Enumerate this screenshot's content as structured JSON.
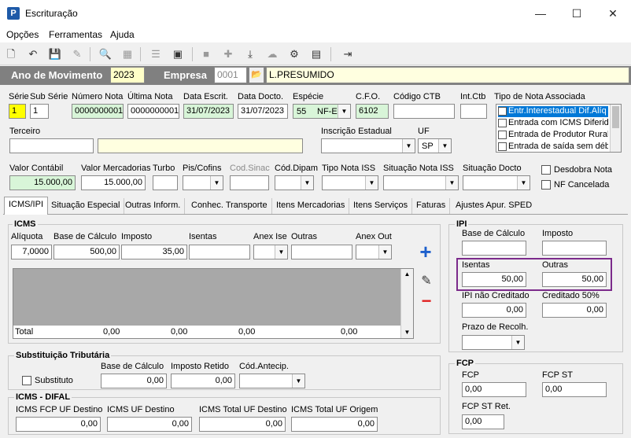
{
  "window": {
    "title": "Escrituração",
    "app_icon": "P",
    "minimize": "—",
    "maximize": "☐",
    "close": "✕"
  },
  "menu": [
    "Opções",
    "Ferramentas",
    "Ajuda"
  ],
  "header": {
    "ano_label": "Ano de Movimento",
    "ano_value": "2023",
    "empresa_label": "Empresa",
    "empresa_code": "0001",
    "empresa_name": "L.PRESUMIDO"
  },
  "doc": {
    "serie_label": "Série",
    "serie": "1",
    "subserie_label": "Sub Série",
    "subserie": "1",
    "numero_label": "Número Nota",
    "numero": "0000000001",
    "ultima_label": "Última Nota",
    "ultima": "0000000001",
    "data_escrit_label": "Data Escrit.",
    "data_escrit": "31/07/2023",
    "data_docto_label": "Data Docto.",
    "data_docto": "31/07/2023",
    "especie_label": "Espécie",
    "especie_code": "55",
    "especie": "NF-E",
    "cfo_label": "C.F.O.",
    "cfo": "6102",
    "codigo_ctb_label": "Código CTB",
    "codigo_ctb": "",
    "int_ctb_label": "Int.Ctb",
    "int_ctb": "",
    "tipo_nota_label": "Tipo de Nota Associada",
    "tipo_nota_items": [
      "Entr.Interestadual Dif.Alíq",
      "Entrada com ICMS Diferido",
      "Entrada de Produtor Rural",
      "Entrada de saída sem débi"
    ]
  },
  "terceiro": {
    "label": "Terceiro",
    "code": "",
    "name": "",
    "ie_label": "Inscrição Estadual",
    "ie": "",
    "uf_label": "UF",
    "uf": "SP"
  },
  "valores": {
    "valor_contabil_label": "Valor Contábil",
    "valor_contabil": "15.000,00",
    "valor_merc_label": "Valor Mercadorias",
    "valor_merc": "15.000,00",
    "turbo_label": "Turbo",
    "piscofins_label": "Pis/Cofins",
    "cod_sinac_label": "Cod.Sinac",
    "cod_dipam_label": "Cód.Dipam",
    "tipo_nota_iss_label": "Tipo Nota ISS",
    "situacao_iss_label": "Situação Nota ISS",
    "situacao_docto_label": "Situação Docto",
    "desdobra_label": "Desdobra Nota",
    "nf_cancelada_label": "NF Cancelada"
  },
  "tabs": [
    "ICMS/IPI",
    "Situação Especial",
    "Outras Inform.",
    "Conhec. Transporte",
    "Itens Mercadorias",
    "Itens Serviços",
    "Faturas",
    "Ajustes Apur. SPED"
  ],
  "icms": {
    "title": "ICMS",
    "aliquota_label": "Alíquota",
    "aliquota": "7,0000",
    "base_label": "Base de Cálculo",
    "base": "500,00",
    "imposto_label": "Imposto",
    "imposto": "35,00",
    "isentas_label": "Isentas",
    "isentas": "",
    "anex_ise_label": "Anex Ise",
    "outras_label": "Outras",
    "outras": "",
    "anex_out_label": "Anex Out",
    "total_label": "Total",
    "totals": [
      "0,00",
      "0,00",
      "0,00",
      "0,00"
    ]
  },
  "ipi": {
    "title": "IPI",
    "base_label": "Base de Cálculo",
    "base": "",
    "imposto_label": "Imposto",
    "imposto": "",
    "isentas_label": "Isentas",
    "isentas": "50,00",
    "outras_label": "Outras",
    "outras": "50,00",
    "nao_cred_label": "IPI não Creditado",
    "nao_cred": "0,00",
    "cred50_label": "Creditado 50%",
    "cred50": "0,00",
    "prazo_label": "Prazo de Recolh."
  },
  "st": {
    "title": "Substituição Tributária",
    "substituto_label": "Substituto",
    "base_label": "Base de Cálculo",
    "base": "0,00",
    "imposto_label": "Imposto Retido",
    "imposto": "0,00",
    "cod_label": "Cód.Antecip."
  },
  "difal": {
    "title": "ICMS - DIFAL",
    "fcp_label": "ICMS FCP UF Destino",
    "fcp": "0,00",
    "uf_dest_label": "ICMS UF Destino",
    "uf_dest": "0,00",
    "total_label": "ICMS Total UF Destino",
    "total": "0,00",
    "origem_label": "ICMS Total UF Origem",
    "origem": "0,00"
  },
  "fcp": {
    "title": "FCP",
    "fcp_label": "FCP",
    "fcp": "0,00",
    "fcp_st_label": "FCP ST",
    "fcp_st": "0,00",
    "fcp_st_ret_label": "FCP ST Ret.",
    "fcp_st_ret": "0,00"
  }
}
